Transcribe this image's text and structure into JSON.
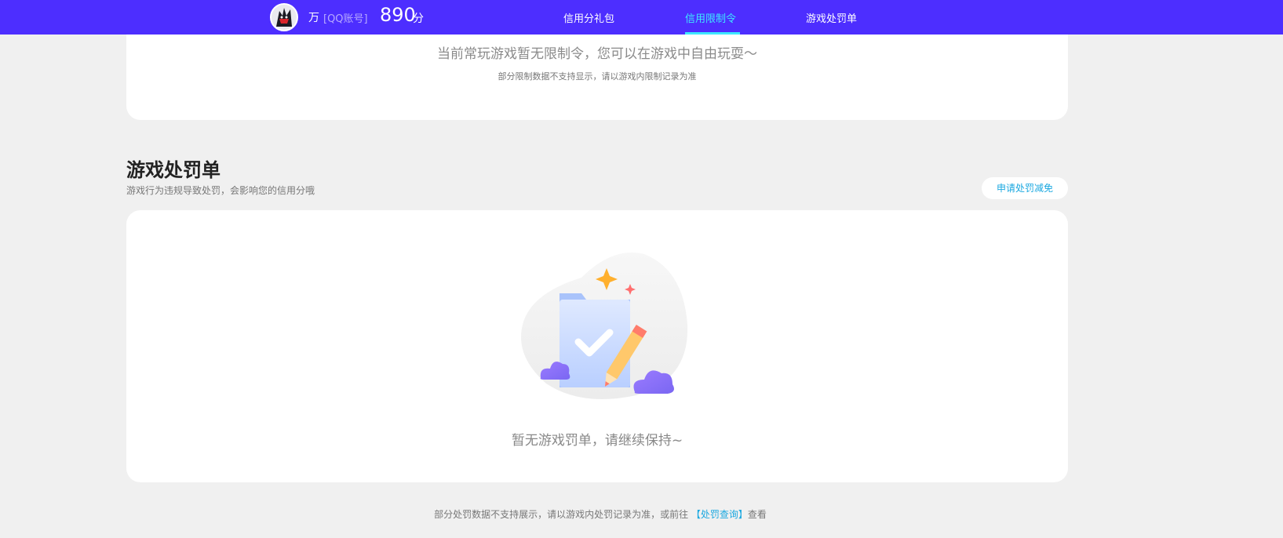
{
  "header": {
    "user_name": "万",
    "account_type": "[QQ账号]",
    "score": "890",
    "score_unit": "分",
    "nav": [
      {
        "label": "信用分礼包",
        "active": false
      },
      {
        "label": "信用限制令",
        "active": true
      },
      {
        "label": "游戏处罚单",
        "active": false
      }
    ]
  },
  "restrictions": {
    "message": "当前常玩游戏暂无限制令，您可以在游戏中自由玩耍～",
    "note": "部分限制数据不支持显示，请以游戏内限制记录为准"
  },
  "penalty": {
    "title": "游戏处罚单",
    "description": "游戏行为违规导致处罚，会影响您的信用分哦",
    "appeal_button": "申请处罚减免",
    "empty_message": "暂无游戏罚单，请继续保持~"
  },
  "footer": {
    "text": "部分处罚数据不支持展示，请以游戏内处罚记录为准，或前往",
    "link": "【处罚查询】",
    "suffix": "查看"
  },
  "colors": {
    "header_bg": "#4d2eff",
    "accent": "#3de8ff",
    "link": "#1ba8e0",
    "page_bg": "#f0f0f0"
  }
}
